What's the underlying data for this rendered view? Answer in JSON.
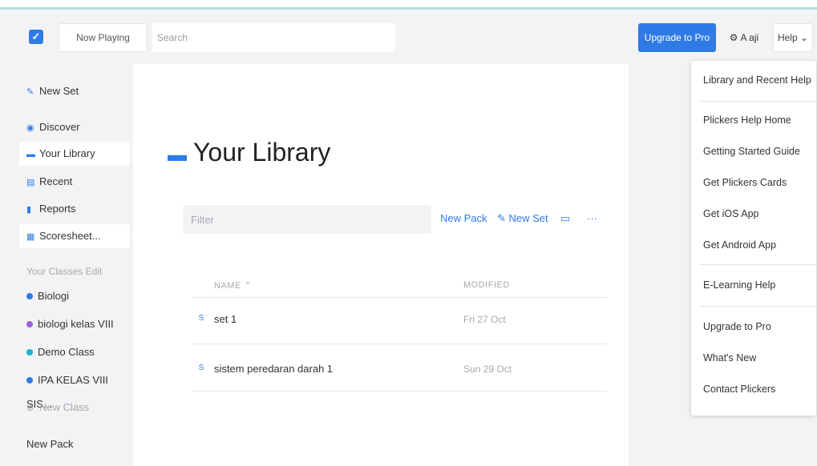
{
  "topbar": {
    "logo": "✓",
    "now_playing": "Now Playing",
    "search_placeholder": "Search",
    "upgrade": "Upgrade to Pro",
    "user": "A aji",
    "help": "Help ⌄"
  },
  "sidebar": {
    "new_set": "New Set",
    "items": [
      "Discover",
      "Your Library",
      "Recent",
      "Reports",
      "Scoresheet..."
    ],
    "classes_label": "Your Classes Edit",
    "classes": [
      {
        "name": "Biologi",
        "color": "#2f7be5"
      },
      {
        "name": "biologi kelas VIII",
        "color": "#9a5fd2"
      },
      {
        "name": "Demo Class",
        "color": "#1ab5c9"
      },
      {
        "name": "IPA KELAS VIII SIS...",
        "color": "#2f7be5"
      }
    ],
    "new_class": "New Class",
    "new_pack": "New Pack"
  },
  "main": {
    "title": "Your Library",
    "filter_placeholder": "Filter",
    "new_pack": "New Pack",
    "new_set": "New Set",
    "more": "···",
    "col_name": "NAME ⌃",
    "col_modified": "MODIFIED",
    "rows": [
      {
        "icon": "S",
        "name": "set 1",
        "modified": "Fri 27 Oct"
      },
      {
        "icon": "S",
        "name": "sistem peredaran darah 1",
        "modified": "Sun 29 Oct"
      }
    ]
  },
  "help_menu": {
    "items": [
      "Library and Recent Help",
      "Plickers Help Home",
      "Getting Started Guide",
      "Get Plickers Cards",
      "Get iOS App",
      "Get Android App",
      "E-Learning Help",
      "Upgrade to Pro",
      "What's New",
      "Contact Plickers"
    ]
  },
  "colors": {
    "accent": "#2f7be5",
    "panel": "#f3f3f5",
    "strip": "#b6dcdc"
  }
}
